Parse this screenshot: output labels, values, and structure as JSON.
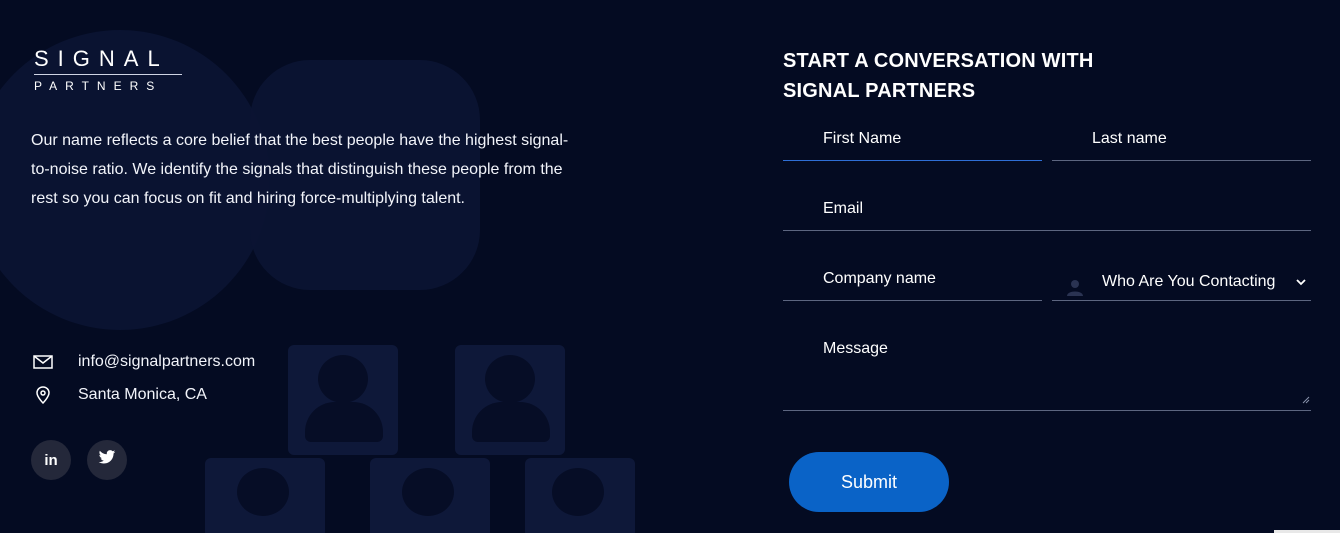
{
  "brand": {
    "logo_top": "SIGNAL",
    "logo_bottom": "PARTNERS"
  },
  "about_text": "Our name reflects a core belief that the best people have the highest signal-to-noise ratio. We identify the signals that distinguish these people from the rest so you can focus on fit and hiring force-multiplying talent.",
  "contact": {
    "email": "info@signalpartners.com",
    "email_icon": "mail-icon",
    "location": "Santa Monica, CA",
    "location_icon": "map-pin-icon"
  },
  "social": {
    "linkedin_icon": "linkedin-icon",
    "linkedin_glyph": "in",
    "twitter_icon": "twitter-icon"
  },
  "form": {
    "title_line1": "START A CONVERSATION WITH",
    "title_line2": "SIGNAL PARTNERS",
    "first_name": "First Name",
    "last_name": "Last name",
    "email": "Email",
    "company": "Company name",
    "contacting": "Who Are You Contacting",
    "message": "Message",
    "submit": "Submit"
  },
  "colors": {
    "background": "#040b22",
    "accent": "#0a63c7",
    "focus_underline": "#2f6fd6"
  }
}
